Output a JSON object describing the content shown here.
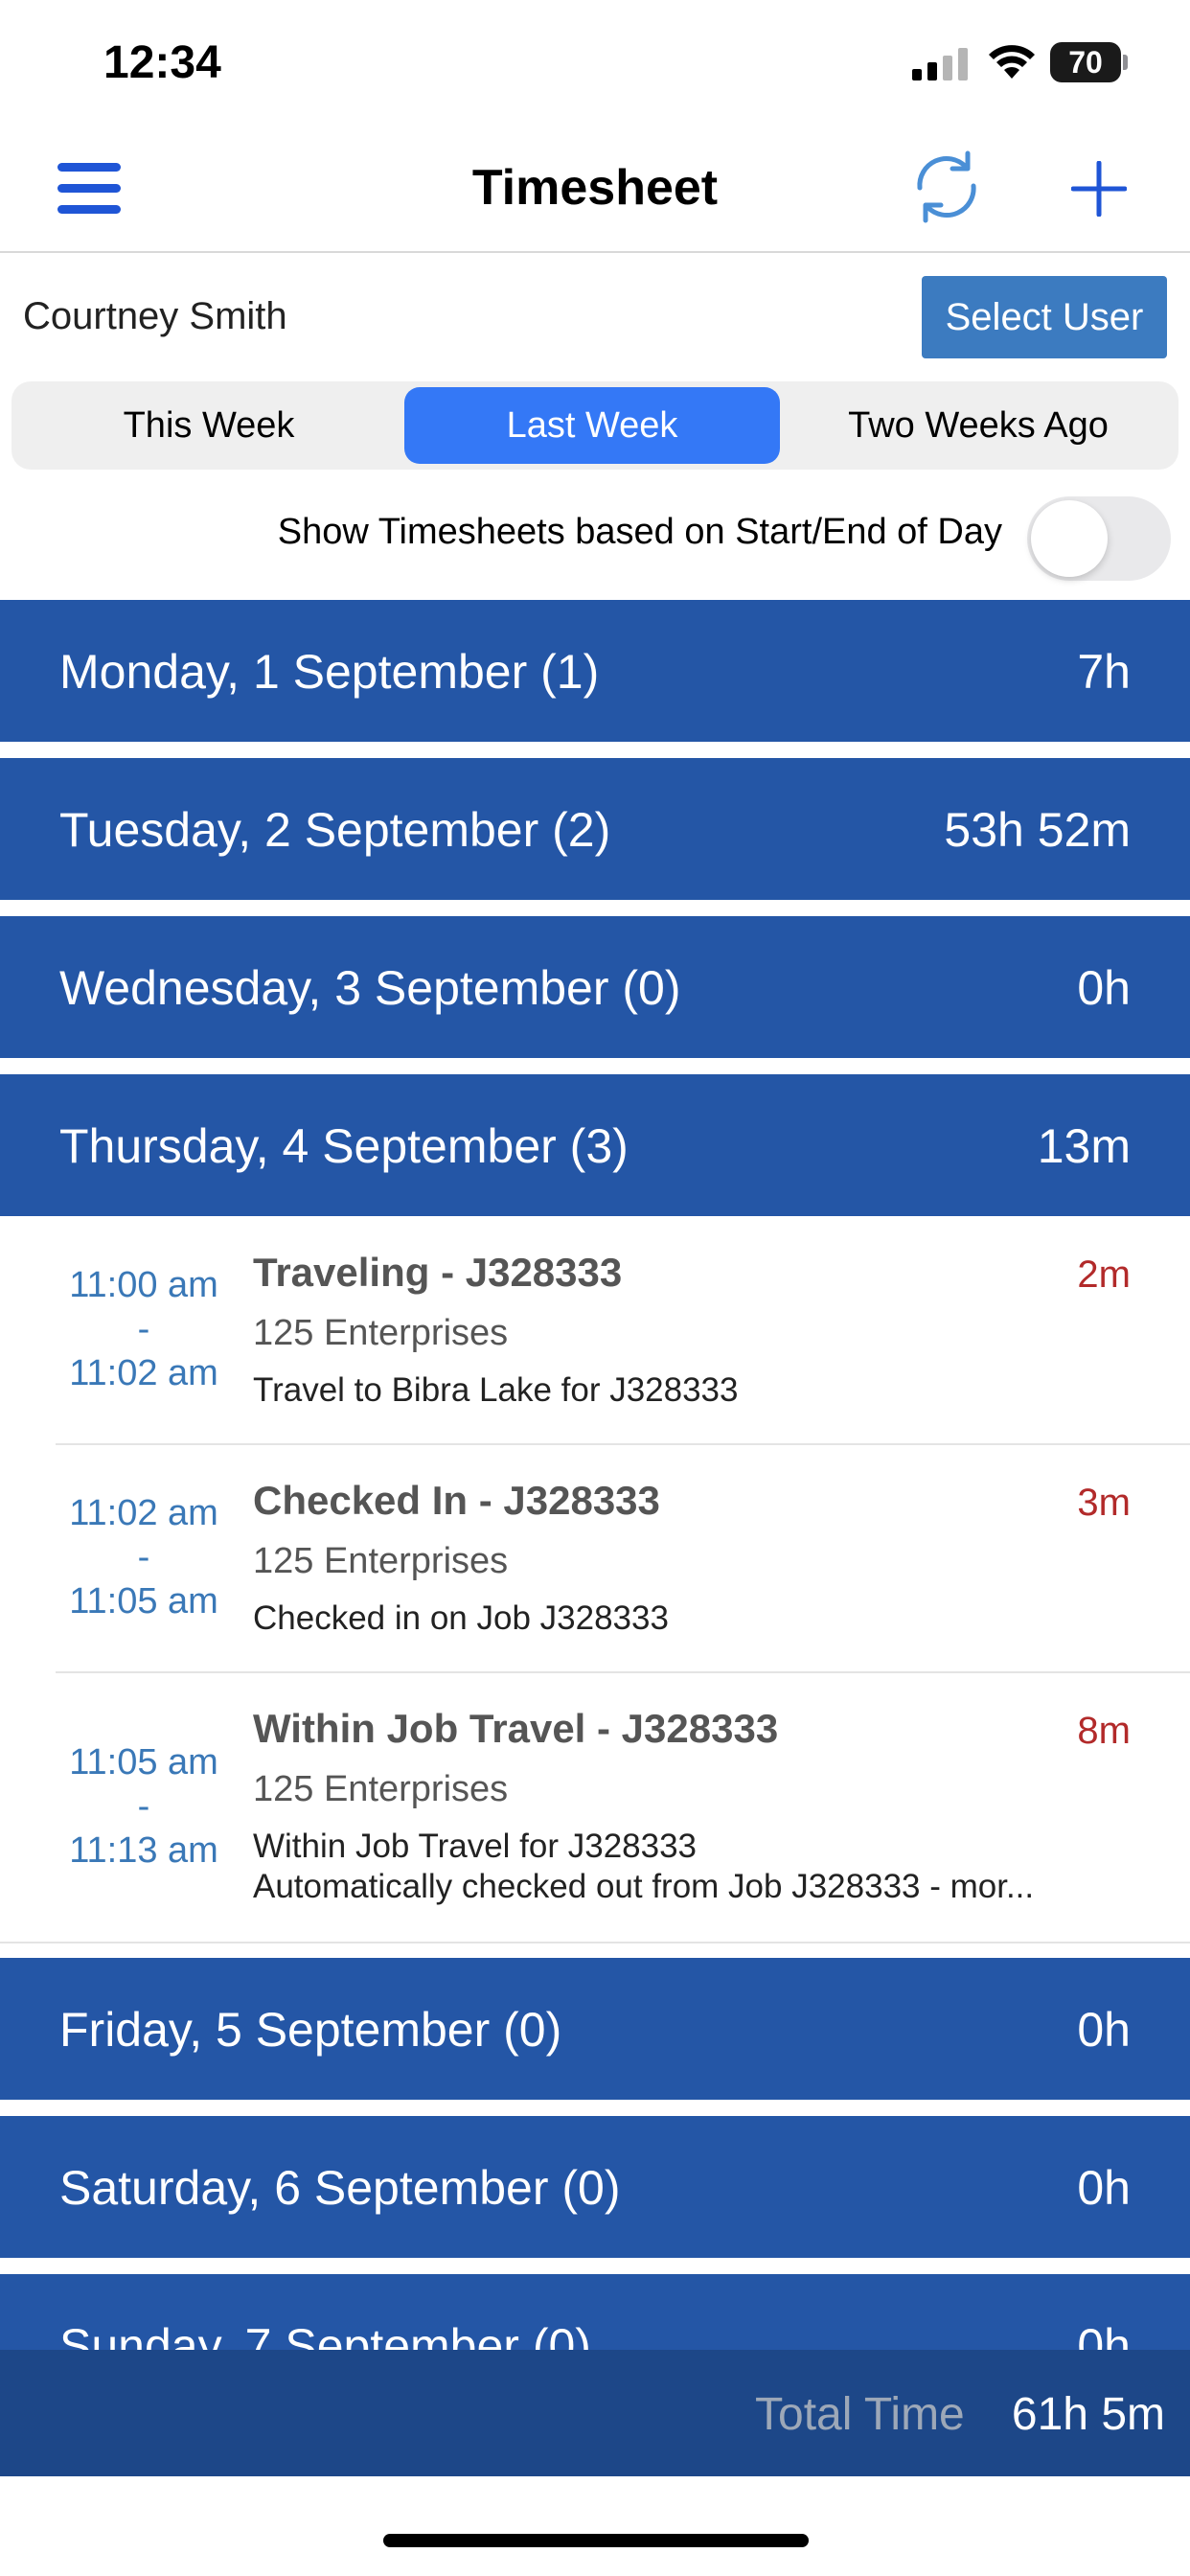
{
  "status_bar": {
    "time": "12:34",
    "battery": "70"
  },
  "nav": {
    "title": "Timesheet"
  },
  "user": {
    "name": "Courtney Smith",
    "select_label": "Select User"
  },
  "tabs": [
    {
      "label": "This Week",
      "active": false
    },
    {
      "label": "Last Week",
      "active": true
    },
    {
      "label": "Two Weeks Ago",
      "active": false
    }
  ],
  "toggle": {
    "label": "Show Timesheets based on Start/End of Day",
    "on": false
  },
  "days": [
    {
      "title": "Monday, 1 September (1)",
      "total": "7h"
    },
    {
      "title": "Tuesday, 2 September (2)",
      "total": "53h 52m"
    },
    {
      "title": "Wednesday, 3 September (0)",
      "total": "0h"
    },
    {
      "title": "Thursday, 4 September (3)",
      "total": "13m"
    },
    {
      "title": "Friday, 5 September (0)",
      "total": "0h"
    },
    {
      "title": "Saturday, 6 September (0)",
      "total": "0h"
    },
    {
      "title": "Sunday, 7 September (0)",
      "total": "0h"
    }
  ],
  "entries": [
    {
      "start": "11:00 am",
      "sep": "-",
      "end": "11:02 am",
      "title": "Traveling - J328333",
      "company": "125 Enterprises",
      "desc1": "Travel to Bibra Lake for J328333",
      "desc2": "",
      "duration": "2m"
    },
    {
      "start": "11:02 am",
      "sep": "-",
      "end": "11:05 am",
      "title": "Checked In - J328333",
      "company": "125 Enterprises",
      "desc1": "Checked in on Job J328333",
      "desc2": "",
      "duration": "3m"
    },
    {
      "start": "11:05 am",
      "sep": "-",
      "end": "11:13 am",
      "title": "Within Job Travel - J328333",
      "company": "125 Enterprises",
      "desc1": "Within Job Travel for J328333",
      "desc2": "Automatically checked out from Job J328333 - mor...",
      "duration": "8m"
    }
  ],
  "footer": {
    "label": "Total Time",
    "value": "61h 5m"
  },
  "colors": {
    "accent": "#1f55d6",
    "day_header": "#2456a6",
    "footer": "#1d4788",
    "select_button": "#3c7bc0",
    "segment_active": "#3478f6",
    "time_text": "#3a78b7",
    "duration_text": "#b22a2a"
  }
}
